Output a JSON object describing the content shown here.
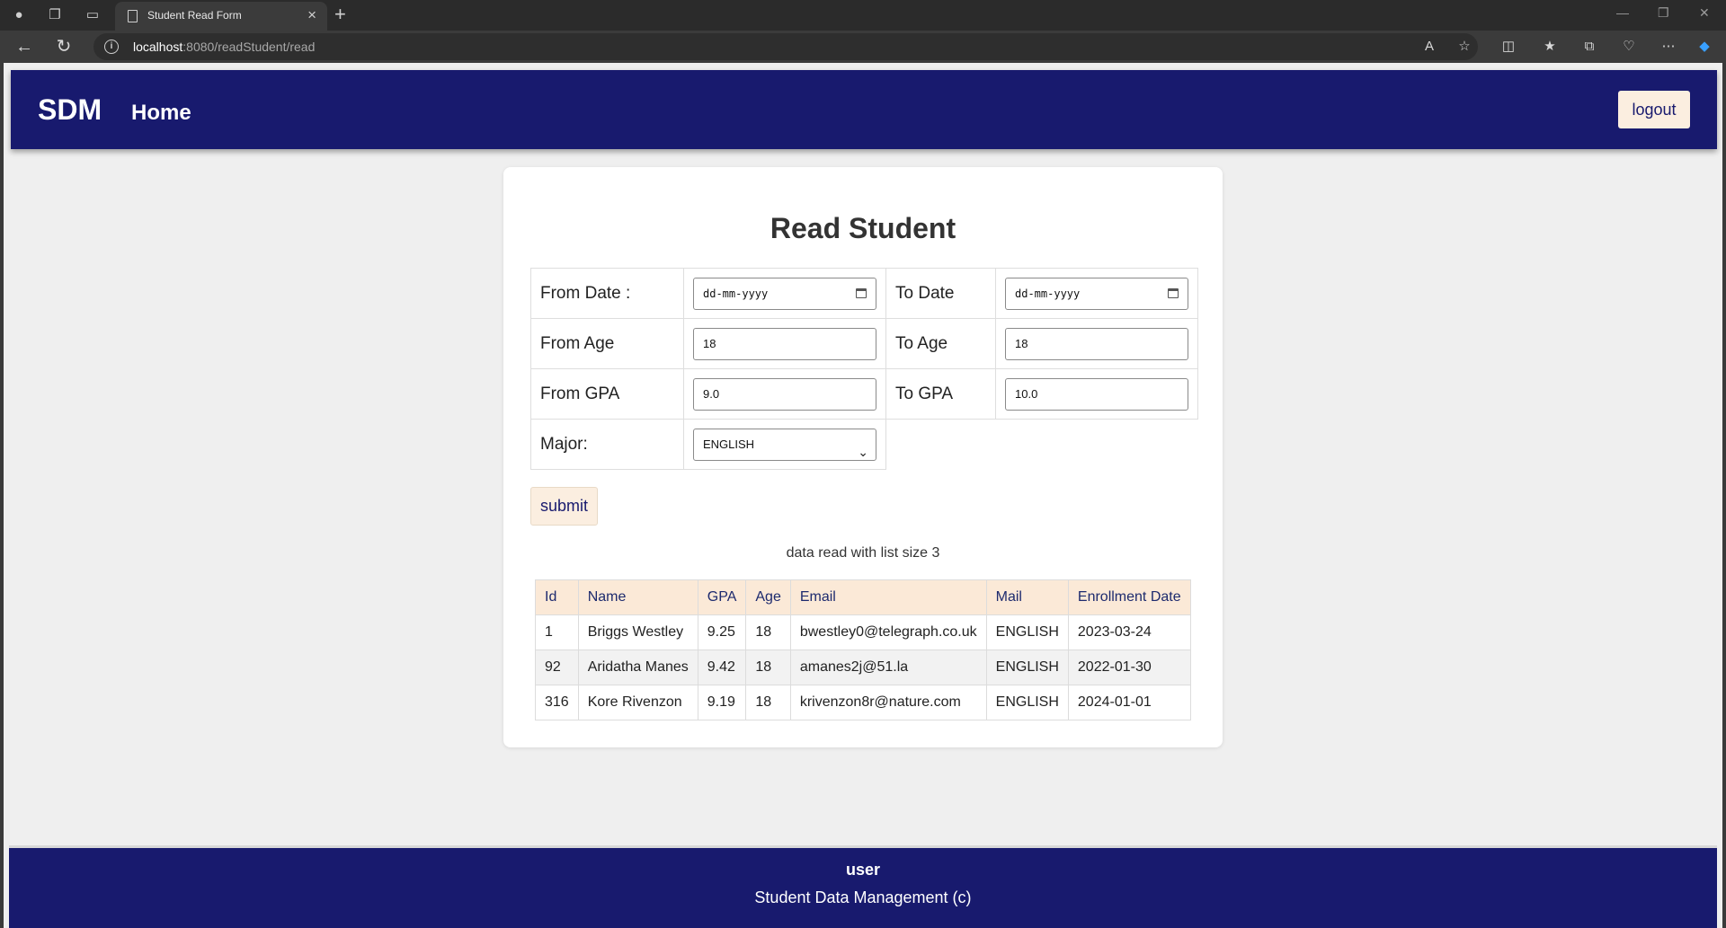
{
  "browser": {
    "tab_title": "Student Read Form",
    "url_host": "localhost",
    "url_path": ":8080/readStudent/read"
  },
  "navbar": {
    "brand": "SDM",
    "home_link": "Home",
    "logout_label": "logout"
  },
  "page": {
    "title": "Read Student"
  },
  "form": {
    "from_date_label": "From Date :",
    "from_date_placeholder": "dd-mm-yyyy",
    "to_date_label": "To Date",
    "to_date_placeholder": "dd-mm-yyyy",
    "from_age_label": "From Age",
    "from_age_value": "18",
    "to_age_label": "To Age",
    "to_age_value": "18",
    "from_gpa_label": "From GPA",
    "from_gpa_value": "9.0",
    "to_gpa_label": "To GPA",
    "to_gpa_value": "10.0",
    "major_label": "Major:",
    "major_value": "ENGLISH",
    "submit_label": "submit"
  },
  "result_message": "data read with list size 3",
  "table": {
    "headers": [
      "Id",
      "Name",
      "GPA",
      "Age",
      "Email",
      "Mail",
      "Enrollment Date"
    ],
    "rows": [
      [
        "1",
        "Briggs Westley",
        "9.25",
        "18",
        "bwestley0@telegraph.co.uk",
        "ENGLISH",
        "2023-03-24"
      ],
      [
        "92",
        "Aridatha Manes",
        "9.42",
        "18",
        "amanes2j@51.la",
        "ENGLISH",
        "2022-01-30"
      ],
      [
        "316",
        "Kore Rivenzon",
        "9.19",
        "18",
        "krivenzon8r@nature.com",
        "ENGLISH",
        "2024-01-01"
      ]
    ]
  },
  "footer": {
    "user": "user",
    "copyright": "Student Data Management (c)"
  }
}
